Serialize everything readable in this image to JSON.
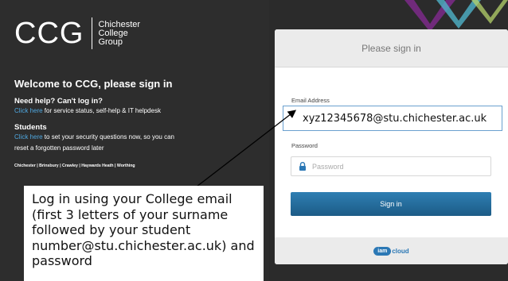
{
  "brand": {
    "logo": "CCG",
    "name_lines": [
      "Chichester",
      "College",
      "Group"
    ]
  },
  "left": {
    "welcome": "Welcome to CCG, please sign in",
    "help_heading": "Need help? Can't log in?",
    "help_link": "Click here",
    "help_text": " for service status, self-help & IT helpdesk",
    "students_heading": "Students",
    "students_link": "Click here",
    "students_text_1": " to set your security questions now, so you can",
    "students_text_2": "reset a forgotten password later",
    "campuses": "Chichester | Brinsbury | Crawley | Haywards Heath | Worthing"
  },
  "card": {
    "title": "Please sign in",
    "email_label": "Email Address",
    "email_value": "xyz12345678@stu.chichester.ac.uk",
    "password_label": "Password",
    "password_placeholder": "Password",
    "signin_label": "Sign in",
    "footer_badge": "iam",
    "footer_text": "cloud"
  },
  "callout": {
    "text": "Log in using your College email (first 3 letters of your surname followed by your student number@stu.chichester.ac.uk) and password"
  },
  "colors": {
    "background": "#2d2d2d",
    "link": "#4fa8e0",
    "button": "#1c5b86",
    "accent_chevrons": [
      "#7d2a8a",
      "#4fb3c9",
      "#b6d36b"
    ]
  }
}
